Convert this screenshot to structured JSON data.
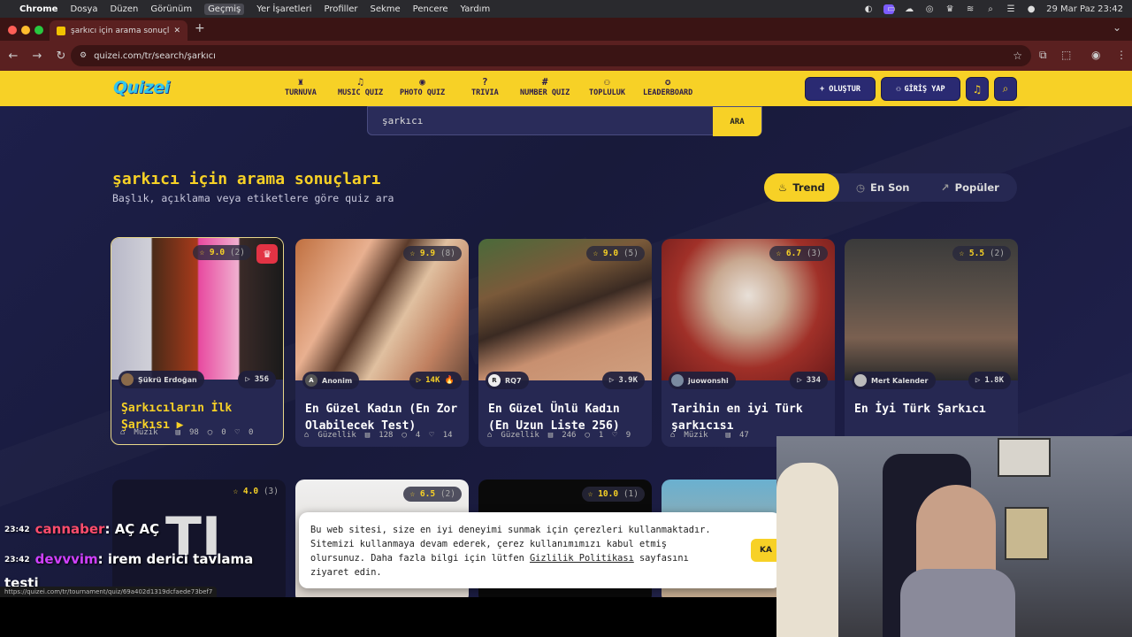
{
  "menubar": {
    "app": "Chrome",
    "items": [
      "Dosya",
      "Düzen",
      "Görünüm",
      "Geçmiş",
      "Yer İşaretleri",
      "Profiller",
      "Sekme",
      "Pencere",
      "Yardım"
    ],
    "clock": "29 Mar Paz  23:42"
  },
  "browser": {
    "tab_title": "şarkıcı için arama sonuçları -",
    "url": "quizei.com/tr/search/şarkıcı"
  },
  "site": {
    "logo": "Quizei",
    "nav": [
      {
        "label": "TURNUVA",
        "icon": "trophy-icon",
        "glyph": "♜"
      },
      {
        "label": "MUSIC QUIZ",
        "icon": "music-icon",
        "glyph": "♫"
      },
      {
        "label": "PHOTO QUIZ",
        "icon": "camera-icon",
        "glyph": "◉"
      },
      {
        "label": "TRIVIA",
        "icon": "question-icon",
        "glyph": "?"
      },
      {
        "label": "NUMBER QUIZ",
        "icon": "hash-icon",
        "glyph": "#"
      },
      {
        "label": "TOPLULUK",
        "icon": "users-icon",
        "glyph": "⚇"
      },
      {
        "label": "LEADERBOARD",
        "icon": "award-icon",
        "glyph": "✪"
      }
    ],
    "create_label": "+ OLUŞTUR",
    "login_label": "GİRİŞ YAP"
  },
  "search": {
    "query": "şarkıcı",
    "button": "ARA"
  },
  "page": {
    "title": "şarkıcı için arama sonuçları",
    "subtitle": "Başlık, açıklama veya etiketlere göre quiz ara"
  },
  "sort": {
    "trend": "Trend",
    "latest": "En Son",
    "popular": "Popüler"
  },
  "cards": [
    {
      "rating": "9.0",
      "count": "(2)",
      "author": "Şükrü Erdoğan",
      "plays": "356",
      "title": "Şarkıcıların İlk Şarkısı ▶",
      "category": "Müzik",
      "items": "98",
      "comments": "0",
      "likes": "0"
    },
    {
      "rating": "9.9",
      "count": "(8)",
      "author": "Anonim",
      "plays": "14K 🔥",
      "title": "En Güzel Kadın (En Zor Olabilecek Test)",
      "category": "Güzellik",
      "items": "128",
      "comments": "4",
      "likes": "14"
    },
    {
      "rating": "9.0",
      "count": "(5)",
      "author": "RQ7",
      "plays": "3.9K",
      "title": "En Güzel Ünlü Kadın (En Uzun Liste 256)",
      "category": "Güzellik",
      "items": "246",
      "comments": "1",
      "likes": "9"
    },
    {
      "rating": "6.7",
      "count": "(3)",
      "author": "juowonshi",
      "plays": "334",
      "title": "Tarihin en iyi Türk şarkıcısı",
      "category": "Müzik",
      "items": "47",
      "comments": "",
      "likes": ""
    },
    {
      "rating": "5.5",
      "count": "(2)",
      "author": "Mert Kalender",
      "plays": "1.8K",
      "title": "En İyi Türk Şarkıcı",
      "category": "",
      "items": "",
      "comments": "",
      "likes": ""
    }
  ],
  "row2": [
    {
      "rating": "4.0",
      "count": "(3)"
    },
    {
      "rating": "6.5",
      "count": "(2)"
    },
    {
      "rating": "10.0",
      "count": "(1)"
    }
  ],
  "cookie": {
    "text_a": "Bu web sitesi, size en iyi deneyimi sunmak için çerezleri kullanmaktadır. Sitemizi kullanmaya devam ederek, çerez kullanımımızı kabul etmiş olursunuz. Daha fazla bilgi için lütfen ",
    "link": "Gizlilik Politikası",
    "text_b": " sayfasını ziyaret edin.",
    "button": "KA"
  },
  "chat": [
    {
      "time": "23:42",
      "user": "cannaber",
      "msg": ": AÇ AÇ",
      "color": "#ff4d6d"
    },
    {
      "time": "23:42",
      "user": "devvvim",
      "msg": ": irem derici tavlama",
      "color": "#d040ff"
    }
  ],
  "chat_cont": "testi",
  "status_url": "https://quizei.com/tr/tournament/quiz/69a402d1319dcfaede73bef7",
  "colors": {
    "brand_yellow": "#f7d126",
    "navy": "#2a2a72",
    "bg": "#1d1f4a"
  }
}
